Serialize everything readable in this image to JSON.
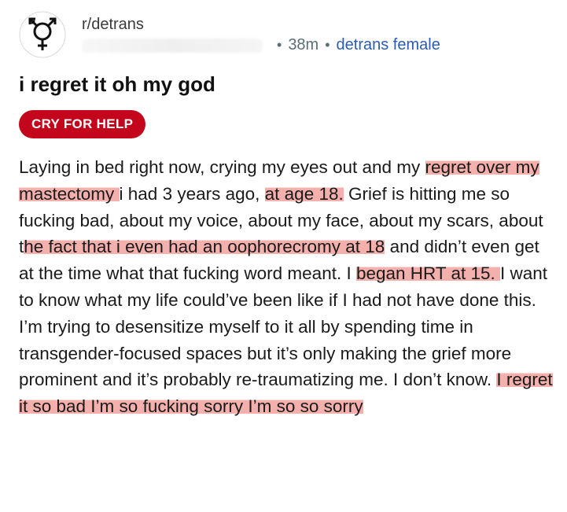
{
  "post": {
    "subreddit": "r/detrans",
    "time": "38m",
    "separator": "•",
    "user_flair": "detrans female",
    "title": "i regret it oh my god",
    "post_flair": "CRY FOR HELP",
    "body_segments": [
      {
        "text": "Laying in bed right now, crying my eyes out and my ",
        "highlight": false
      },
      {
        "text": "regret over my mastectomy ",
        "highlight": true
      },
      {
        "text": "i had 3 years ago, ",
        "highlight": false
      },
      {
        "text": "at age 18.",
        "highlight": true
      },
      {
        "text": " Grief is hitting me so fucking bad, about my voice, about my face, about my scars, about t",
        "highlight": false
      },
      {
        "text": "he fact that i even had an oophorecromy at 18",
        "highlight": true
      },
      {
        "text": " and didn’t even get at the time what that fucking word meant. I ",
        "highlight": false
      },
      {
        "text": "began HRT at 15. ",
        "highlight": true
      },
      {
        "text": "I want to know what my life could’ve been like if I had not have done this. I’m trying to desensitize myself to it all by spending time in transgender-focused spaces but it’s only making the grief more prominent and it’s probably re-traumatizing me. I don’t know. ",
        "highlight": false
      },
      {
        "text": "I regret it so bad I’m so fucking sorry I’m so so sorry",
        "highlight": true
      }
    ]
  },
  "colors": {
    "flair_bg": "#c4061d",
    "highlight": "#f4b0ac",
    "user_flair": "#2a5db0"
  },
  "icons": {
    "subreddit_avatar": "gender-symbol-icon"
  }
}
